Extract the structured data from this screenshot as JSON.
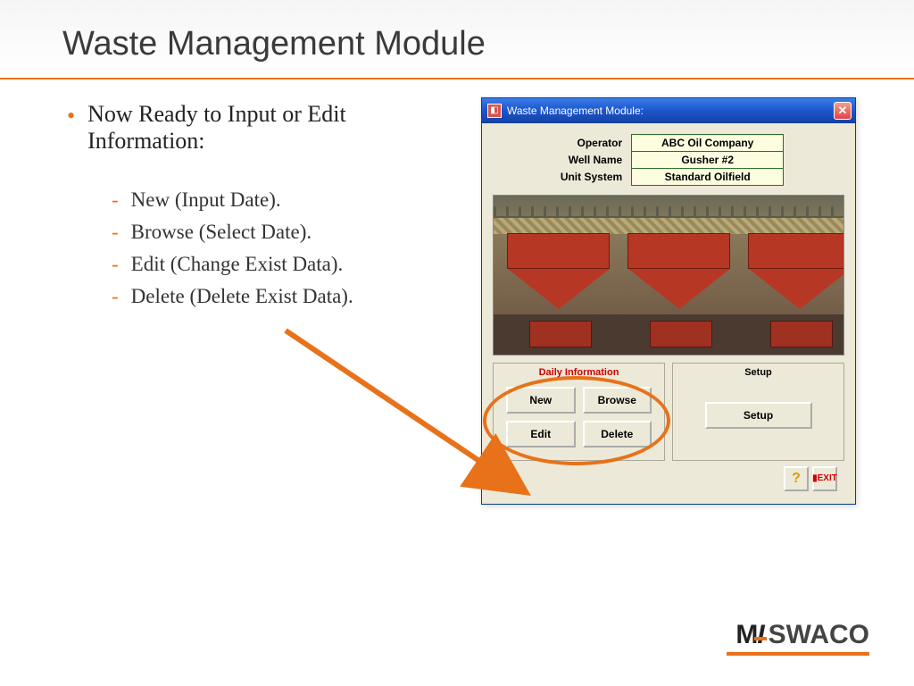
{
  "slide": {
    "title": "Waste Management Module",
    "main_bullet": "Now Ready to Input or Edit Information:",
    "sub_bullets": [
      "New (Input Date).",
      "Browse (Select Date).",
      "Edit (Change Exist Data).",
      "Delete (Delete Exist Data)."
    ]
  },
  "window": {
    "title": "Waste Management Module:",
    "fields": {
      "operator_label": "Operator",
      "operator_value": "ABC Oil Company",
      "wellname_label": "Well Name",
      "wellname_value": "Gusher #2",
      "unitsystem_label": "Unit System",
      "unitsystem_value": "Standard Oilfield"
    },
    "daily_info_title": "Daily Information",
    "setup_title": "Setup",
    "buttons": {
      "new": "New",
      "browse": "Browse",
      "edit": "Edit",
      "delete": "Delete",
      "setup": "Setup"
    },
    "help_symbol": "?",
    "exit_label": "EXIT"
  },
  "logo": {
    "part1": "M",
    "part2": "SWACO"
  }
}
